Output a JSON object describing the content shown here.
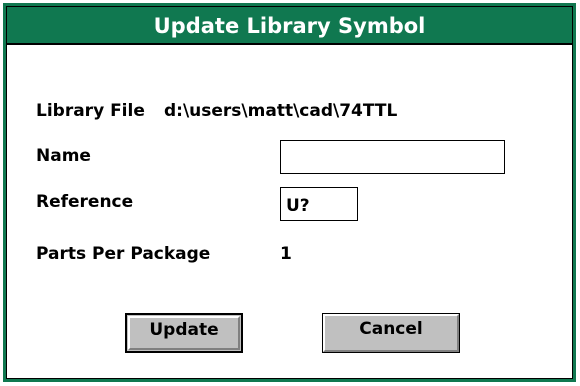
{
  "dialog": {
    "title": "Update Library Symbol",
    "library_file_label": "Library File",
    "library_file_value": "d:\\users\\matt\\cad\\74TTL",
    "name_label": "Name",
    "name_value": "",
    "reference_label": "Reference",
    "reference_value": "U?",
    "parts_per_package_label": "Parts Per Package",
    "parts_per_package_value": "1",
    "update_button": "Update",
    "cancel_button": "Cancel"
  },
  "colors": {
    "title_bar": "#107850",
    "button_face": "#c0c0c0"
  }
}
